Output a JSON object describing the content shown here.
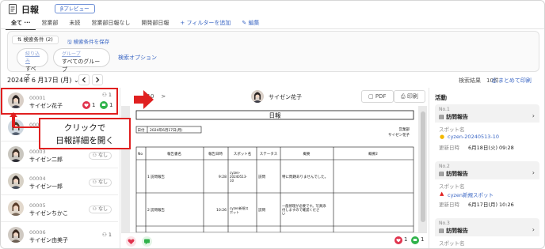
{
  "header": {
    "title": "日報",
    "preview_badge": "βプレビュー",
    "tabs": [
      "全て ···",
      "営業部",
      "未読",
      "営業部日報なし",
      "開発部日報"
    ],
    "add_filter": "+ フィルターを追加",
    "edit": "編集"
  },
  "search": {
    "conditions_label": "検索条件 (2)",
    "save_conditions": "検索条件を保存",
    "chip1_small": "絞り込み",
    "chip1_value": "すべて",
    "chip2_small": "グループ",
    "chip2_value": "すべてのグループ",
    "options": "検索オプション"
  },
  "date_bar": {
    "date": "2024年 6 月17日 (月)",
    "results": "検索結果　10件",
    "collapse": "まとめて印刷"
  },
  "list": {
    "items": [
      {
        "code": "00001",
        "name": "サイゼン花子",
        "badge": "1",
        "likes": "1",
        "comments": "1"
      },
      {
        "code": "00002",
        "name": "",
        "badge": "なし"
      },
      {
        "code": "00003",
        "name": "サイゼン二郎",
        "badge": "なし"
      },
      {
        "code": "00004",
        "name": "サイゼン一郎",
        "badge": "なし"
      },
      {
        "code": "00005",
        "name": "サイゼンちかこ",
        "badge": "なし"
      },
      {
        "code": "00006",
        "name": "サイゼン由美子",
        "badge": "1"
      }
    ]
  },
  "callout": {
    "line1": "クリックで",
    "line2": "日報詳細を開く"
  },
  "doc": {
    "pager": "/ 10",
    "pager_next": ">",
    "person": "サイゼン花子",
    "pdf": "PDF",
    "print": "印刷",
    "paper_title": "日報",
    "date_label": "日付",
    "date_value": "2024年6月17日(月)",
    "dept": "営業部",
    "person_right": "サイゼン花子",
    "table_headers": [
      "No",
      "報告書名",
      "報告日時",
      "スポット名",
      "ステータス",
      "概要",
      "概要2"
    ],
    "rows": [
      {
        "no": "1",
        "title": "訪問報告",
        "time": "9:28",
        "spot": "cyzen-20240513-10",
        "status": "訪問",
        "summary": "特に問題ありませんでした。"
      },
      {
        "no": "2",
        "title": "訪問報告",
        "time": "10:26",
        "spot": "cyzen新規スポット",
        "status": "訪問",
        "summary": "一般修理が必要です。写真添付しますので確認ください"
      }
    ],
    "footer_likes": "1",
    "footer_comments": "1"
  },
  "activity": {
    "title": "活動",
    "cards": [
      {
        "no": "No.1",
        "type": "訪問報告",
        "spot_label": "スポット名",
        "spot": "cyzen-20240513-10",
        "dt_label": "更新日時",
        "dt": "6月18日(火) 09:28"
      },
      {
        "no": "No.2",
        "type": "訪問報告",
        "spot_label": "スポット名",
        "spot": "cyzen新規スポット",
        "dt_label": "更新日時",
        "dt": "6月17日(月) 10:26"
      },
      {
        "no": "No.3",
        "type": "訪問報告",
        "spot_label": "スポット名",
        "spot": "",
        "dt_label": "",
        "dt": ""
      }
    ]
  },
  "colors": {
    "accent": "#3a66c4",
    "highlight": "#e02020",
    "like": "#e0334d",
    "comment": "#2fb24a"
  }
}
